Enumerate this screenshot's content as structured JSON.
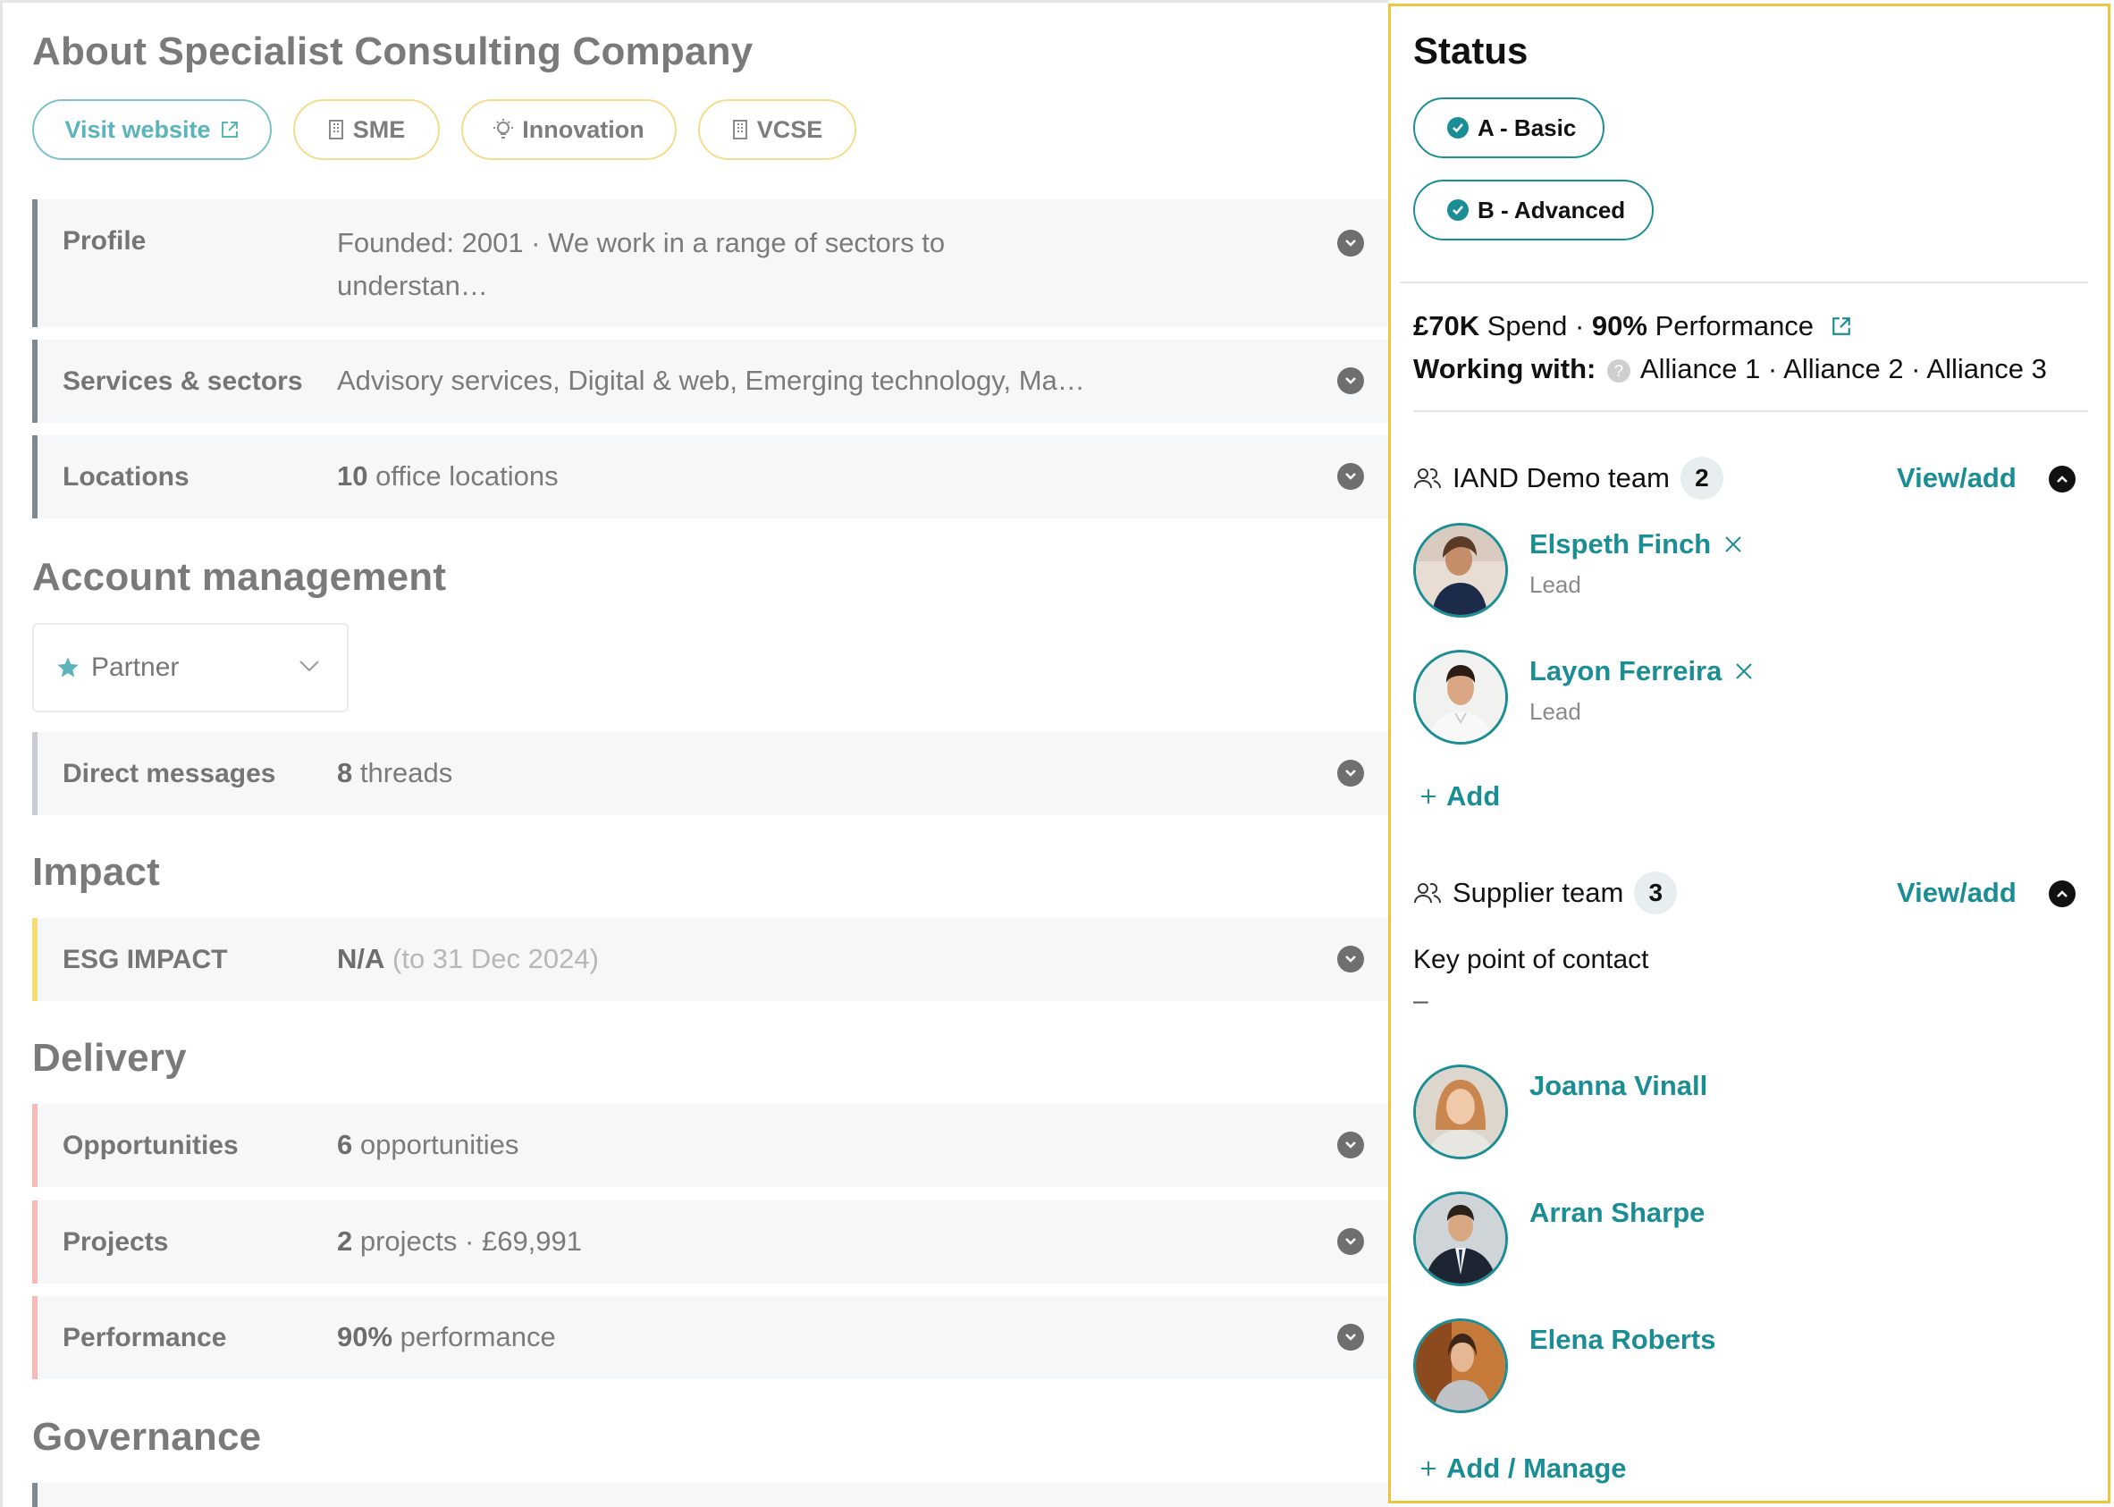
{
  "about": {
    "title": "About Specialist Consulting Company",
    "tags": [
      {
        "label": "Visit website",
        "icon": "external-link-icon"
      },
      {
        "label": "SME",
        "icon": "building-icon"
      },
      {
        "label": "Innovation",
        "icon": "lightbulb-icon"
      },
      {
        "label": "VCSE",
        "icon": "building-icon"
      }
    ],
    "rows": [
      {
        "label": "Profile",
        "value_line1": "Founded: 2001 · We work in a range of sectors to",
        "value_line2": "understan…"
      },
      {
        "label": "Services & sectors",
        "value": "Advisory services, Digital & web, Emerging technology, Ma…"
      },
      {
        "label": "Locations",
        "value_bold": "10",
        "value_rest": " office locations"
      }
    ]
  },
  "account": {
    "title": "Account management",
    "select_value": "Partner",
    "rows": [
      {
        "label": "Direct messages",
        "value_bold": "8",
        "value_rest": " threads"
      }
    ]
  },
  "impact": {
    "title": "Impact",
    "rows": [
      {
        "label": "ESG IMPACT",
        "value_bold": "N/A",
        "value_muted": " (to 31 Dec 2024)"
      }
    ]
  },
  "delivery": {
    "title": "Delivery",
    "rows": [
      {
        "label": "Opportunities",
        "value_bold": "6",
        "value_rest": " opportunities"
      },
      {
        "label": "Projects",
        "value_bold": "2",
        "value_rest": " projects · £69,991"
      },
      {
        "label": "Performance",
        "value_bold": "90%",
        "value_rest": " performance"
      }
    ]
  },
  "governance": {
    "title": "Governance"
  },
  "status": {
    "title": "Status",
    "badges": [
      "A - Basic",
      "B - Advanced"
    ],
    "spend_bold": "£70K",
    "spend_label": " Spend · ",
    "perf_bold": "90%",
    "perf_label": " Performance",
    "working_label": "Working with:",
    "working_value": "Alliance 1 · Alliance 2 · Alliance 3"
  },
  "iand_team": {
    "name": "IAND Demo team",
    "count": "2",
    "view_add": "View/add",
    "members": [
      {
        "name": "Elspeth Finch",
        "role": "Lead"
      },
      {
        "name": "Layon Ferreira",
        "role": "Lead"
      }
    ],
    "add_label": "Add"
  },
  "supplier_team": {
    "name": "Supplier team",
    "count": "3",
    "view_add": "View/add",
    "key_contact_label": "Key point of contact",
    "key_contact_value": "–",
    "members": [
      {
        "name": "Joanna Vinall"
      },
      {
        "name": "Arran Sharpe"
      },
      {
        "name": "Elena Roberts"
      }
    ],
    "add_label": "Add / Manage"
  },
  "colors": {
    "teal": "#1b8e95",
    "panel_border": "#eec53f",
    "row_bg": "#f6f7f9"
  }
}
